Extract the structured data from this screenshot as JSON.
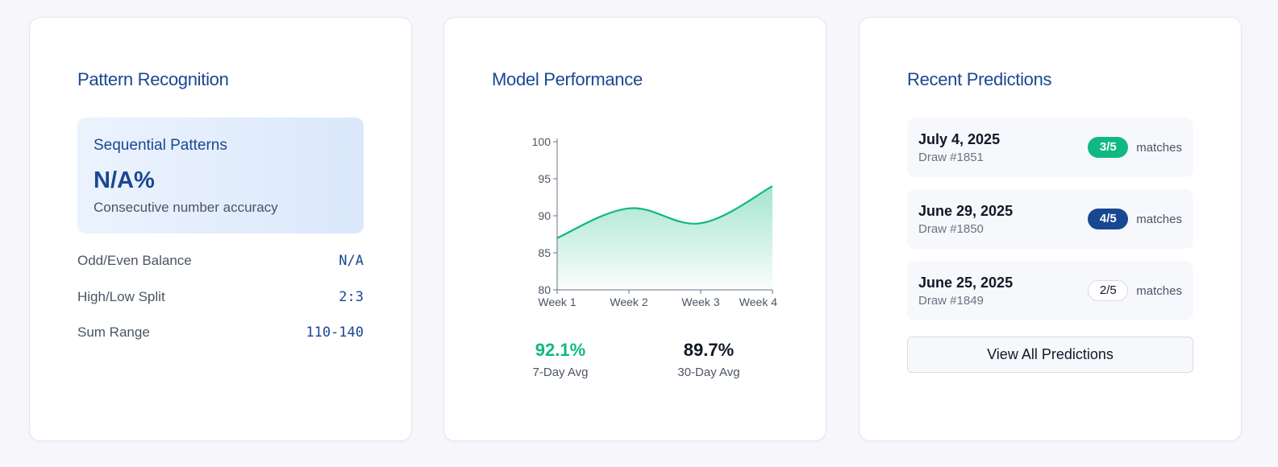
{
  "pattern_recognition": {
    "title": "Pattern Recognition",
    "sequential": {
      "title": "Sequential Patterns",
      "value": "N/A%",
      "description": "Consecutive number accuracy"
    },
    "stats": [
      {
        "label": "Odd/Even Balance",
        "value": "N/A"
      },
      {
        "label": "High/Low Split",
        "value": "2:3"
      },
      {
        "label": "Sum Range",
        "value": "110-140"
      }
    ]
  },
  "model_performance": {
    "title": "Model Performance",
    "kpis": [
      {
        "value": "92.1%",
        "label": "7-Day Avg",
        "color": "#10b981"
      },
      {
        "value": "89.7%",
        "label": "30-Day Avg",
        "color": "#111827"
      }
    ]
  },
  "chart_data": {
    "type": "area",
    "categories": [
      "Week 1",
      "Week 2",
      "Week 3",
      "Week 4"
    ],
    "series": [
      {
        "values": [
          87,
          91,
          89,
          94
        ]
      }
    ],
    "title": "",
    "xlabel": "",
    "ylabel": "",
    "ylim": [
      80,
      100
    ],
    "yticks": [
      80,
      85,
      90,
      95,
      100
    ],
    "grid": false,
    "legend": "none",
    "line_color": "#10b981",
    "fill_color": "#10b981"
  },
  "recent_predictions": {
    "title": "Recent Predictions",
    "items": [
      {
        "date": "July 4, 2025",
        "draw": "Draw #1851",
        "matches": "3/5",
        "matches_label": "matches",
        "badge_style": "green"
      },
      {
        "date": "June 29, 2025",
        "draw": "Draw #1850",
        "matches": "4/5",
        "matches_label": "matches",
        "badge_style": "blue"
      },
      {
        "date": "June 25, 2025",
        "draw": "Draw #1849",
        "matches": "2/5",
        "matches_label": "matches",
        "badge_style": "outline"
      }
    ],
    "view_all_label": "View All Predictions"
  },
  "colors": {
    "brand_blue": "#1a4792",
    "success_green": "#10b981",
    "card_border": "#e3e6ef",
    "page_bg": "#f7f7fb"
  }
}
